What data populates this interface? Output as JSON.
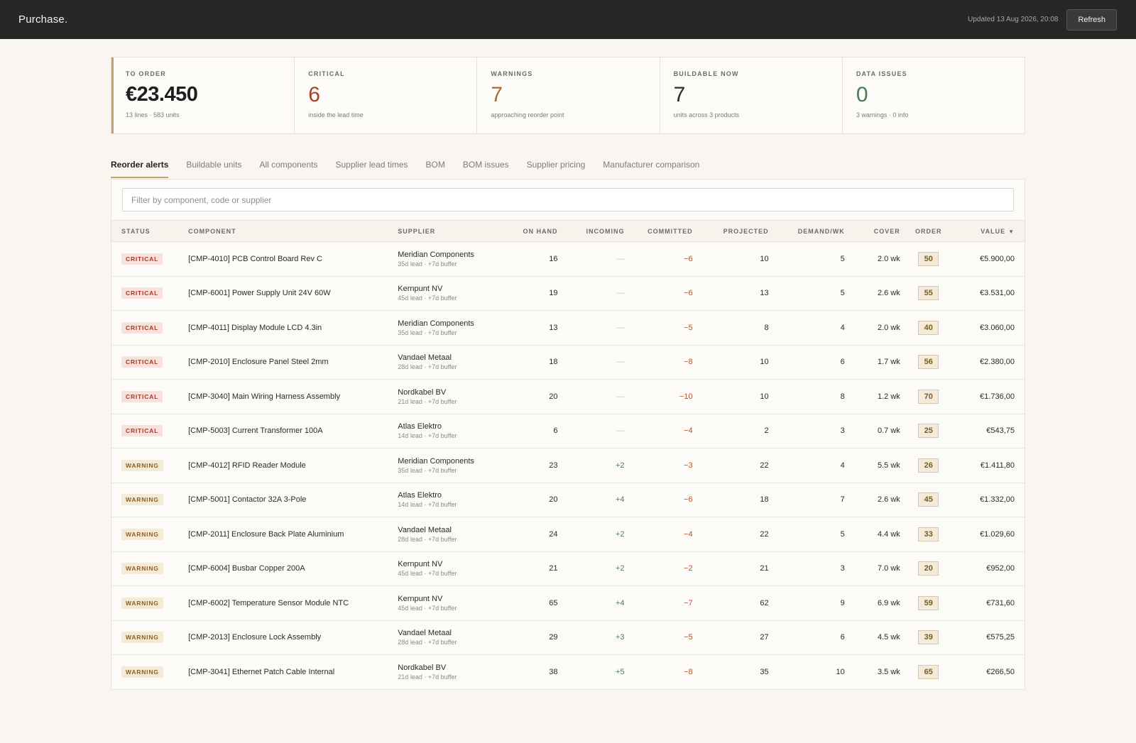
{
  "app": {
    "brand": "Purchase."
  },
  "header": {
    "updated": "Updated 13 Aug 2026, 20:08",
    "refresh_label": "Refresh"
  },
  "kpis": [
    {
      "label": "TO ORDER",
      "value": "€23.450",
      "sub": "13 lines · 583 units"
    },
    {
      "label": "CRITICAL",
      "value": "6",
      "sub": "inside the lead time"
    },
    {
      "label": "WARNINGS",
      "value": "7",
      "sub": "approaching reorder point"
    },
    {
      "label": "BUILDABLE NOW",
      "value": "7",
      "sub": "units across 3 products"
    },
    {
      "label": "DATA ISSUES",
      "value": "0",
      "sub": "3 warnings · 0 info"
    }
  ],
  "tabs": [
    "Reorder alerts",
    "Buildable units",
    "All components",
    "Supplier lead times",
    "BOM",
    "BOM issues",
    "Supplier pricing",
    "Manufacturer comparison"
  ],
  "filter": {
    "placeholder": "Filter by component, code or supplier"
  },
  "columns": [
    "STATUS",
    "COMPONENT",
    "SUPPLIER",
    "ON HAND",
    "INCOMING",
    "COMMITTED",
    "PROJECTED",
    "DEMAND/WK",
    "COVER",
    "ORDER",
    "VALUE"
  ],
  "sort_indicator": "▼",
  "colors": {
    "accent": "#c3a470",
    "critical": "#a83a24",
    "warning": "#8c6122",
    "topbar": "#272727"
  },
  "rows": [
    {
      "status": "CRITICAL",
      "component": "[CMP-4010] PCB Control Board Rev C",
      "supplier": "Meridian Components",
      "lead": "35d lead · +7d buffer",
      "on_hand": "16",
      "incoming": "—",
      "committed": "−6",
      "projected": "10",
      "demand": "5",
      "cover": "2.0 wk",
      "order": "50",
      "value": "€5.900,00"
    },
    {
      "status": "CRITICAL",
      "component": "[CMP-6001] Power Supply Unit 24V 60W",
      "supplier": "Kernpunt NV",
      "lead": "45d lead · +7d buffer",
      "on_hand": "19",
      "incoming": "—",
      "committed": "−6",
      "projected": "13",
      "demand": "5",
      "cover": "2.6 wk",
      "order": "55",
      "value": "€3.531,00"
    },
    {
      "status": "CRITICAL",
      "component": "[CMP-4011] Display Module LCD 4.3in",
      "supplier": "Meridian Components",
      "lead": "35d lead · +7d buffer",
      "on_hand": "13",
      "incoming": "—",
      "committed": "−5",
      "projected": "8",
      "demand": "4",
      "cover": "2.0 wk",
      "order": "40",
      "value": "€3.060,00"
    },
    {
      "status": "CRITICAL",
      "component": "[CMP-2010] Enclosure Panel Steel 2mm",
      "supplier": "Vandael Metaal",
      "lead": "28d lead · +7d buffer",
      "on_hand": "18",
      "incoming": "—",
      "committed": "−8",
      "projected": "10",
      "demand": "6",
      "cover": "1.7 wk",
      "order": "56",
      "value": "€2.380,00"
    },
    {
      "status": "CRITICAL",
      "component": "[CMP-3040] Main Wiring Harness Assembly",
      "supplier": "Nordkabel BV",
      "lead": "21d lead · +7d buffer",
      "on_hand": "20",
      "incoming": "—",
      "committed": "−10",
      "projected": "10",
      "demand": "8",
      "cover": "1.2 wk",
      "order": "70",
      "value": "€1.736,00"
    },
    {
      "status": "CRITICAL",
      "component": "[CMP-5003] Current Transformer 100A",
      "supplier": "Atlas Elektro",
      "lead": "14d lead · +7d buffer",
      "on_hand": "6",
      "incoming": "—",
      "committed": "−4",
      "projected": "2",
      "demand": "3",
      "cover": "0.7 wk",
      "order": "25",
      "value": "€543,75"
    },
    {
      "status": "WARNING",
      "component": "[CMP-4012] RFID Reader Module",
      "supplier": "Meridian Components",
      "lead": "35d lead · +7d buffer",
      "on_hand": "23",
      "incoming": "+2",
      "committed": "−3",
      "projected": "22",
      "demand": "4",
      "cover": "5.5 wk",
      "order": "26",
      "value": "€1.411,80"
    },
    {
      "status": "WARNING",
      "component": "[CMP-5001] Contactor 32A 3-Pole",
      "supplier": "Atlas Elektro",
      "lead": "14d lead · +7d buffer",
      "on_hand": "20",
      "incoming": "+4",
      "committed": "−6",
      "projected": "18",
      "demand": "7",
      "cover": "2.6 wk",
      "order": "45",
      "value": "€1.332,00"
    },
    {
      "status": "WARNING",
      "component": "[CMP-2011] Enclosure Back Plate Aluminium",
      "supplier": "Vandael Metaal",
      "lead": "28d lead · +7d buffer",
      "on_hand": "24",
      "incoming": "+2",
      "committed": "−4",
      "projected": "22",
      "demand": "5",
      "cover": "4.4 wk",
      "order": "33",
      "value": "€1.029,60"
    },
    {
      "status": "WARNING",
      "component": "[CMP-6004] Busbar Copper 200A",
      "supplier": "Kernpunt NV",
      "lead": "45d lead · +7d buffer",
      "on_hand": "21",
      "incoming": "+2",
      "committed": "−2",
      "projected": "21",
      "demand": "3",
      "cover": "7.0 wk",
      "order": "20",
      "value": "€952,00"
    },
    {
      "status": "WARNING",
      "component": "[CMP-6002] Temperature Sensor Module NTC",
      "supplier": "Kernpunt NV",
      "lead": "45d lead · +7d buffer",
      "on_hand": "65",
      "incoming": "+4",
      "committed": "−7",
      "projected": "62",
      "demand": "9",
      "cover": "6.9 wk",
      "order": "59",
      "value": "€731,60"
    },
    {
      "status": "WARNING",
      "component": "[CMP-2013] Enclosure Lock Assembly",
      "supplier": "Vandael Metaal",
      "lead": "28d lead · +7d buffer",
      "on_hand": "29",
      "incoming": "+3",
      "committed": "−5",
      "projected": "27",
      "demand": "6",
      "cover": "4.5 wk",
      "order": "39",
      "value": "€575,25"
    },
    {
      "status": "WARNING",
      "component": "[CMP-3041] Ethernet Patch Cable Internal",
      "supplier": "Nordkabel BV",
      "lead": "21d lead · +7d buffer",
      "on_hand": "38",
      "incoming": "+5",
      "committed": "−8",
      "projected": "35",
      "demand": "10",
      "cover": "3.5 wk",
      "order": "65",
      "value": "€266,50"
    }
  ]
}
